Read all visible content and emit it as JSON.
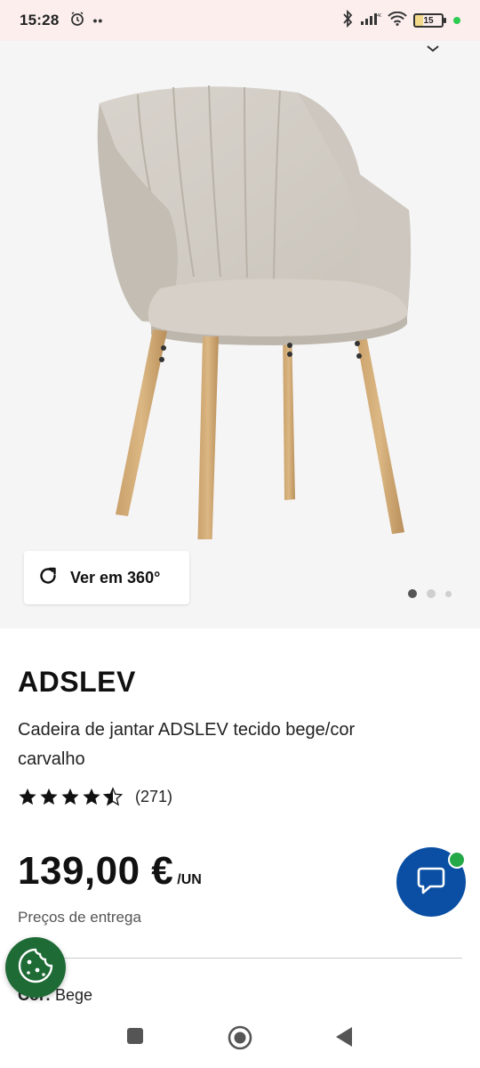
{
  "status_bar": {
    "time": "15:28",
    "more_dots": "••",
    "battery_level": "15",
    "icons": [
      "alarm-icon",
      "bluetooth-icon",
      "signal-icon",
      "wifi-icon",
      "battery-icon"
    ]
  },
  "gallery": {
    "view360_label": "Ver em 360°",
    "total_images": 3,
    "active_index": 0
  },
  "product": {
    "name": "ADSLEV",
    "description": "Cadeira de jantar ADSLEV tecido bege/cor carvalho",
    "rating": 4.5,
    "review_count": "(271)",
    "price": "139,00 €",
    "price_unit": "/UN",
    "delivery_prices_label": "Preços de entrega",
    "color_key": "Cor:",
    "color_value": "Bege"
  },
  "colors": {
    "status_bar_bg": "#fbeeed",
    "image_bg": "#f5f5f5",
    "chat_button": "#0a4fa3",
    "online_dot": "#25a848",
    "cookie_button": "#1e6b36"
  }
}
